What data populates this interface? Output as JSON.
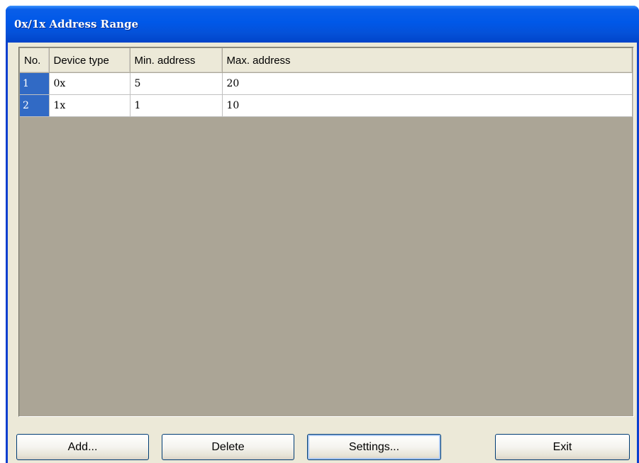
{
  "window": {
    "title": "0x/1x Address Range"
  },
  "table": {
    "columns": [
      "No.",
      "Device type",
      "Min. address",
      "Max. address"
    ],
    "rows": [
      {
        "no": "1",
        "device_type": "0x",
        "min": "5",
        "max": "20"
      },
      {
        "no": "2",
        "device_type": "1x",
        "min": "1",
        "max": "10"
      }
    ]
  },
  "buttons": {
    "add": "Add...",
    "delete": "Delete",
    "settings": "Settings...",
    "exit": "Exit"
  },
  "colors": {
    "title_bar": "#0058e8",
    "dialog_bg": "#ece9d8",
    "grid_empty_bg": "#aba596",
    "row_selector": "#316ac5"
  }
}
